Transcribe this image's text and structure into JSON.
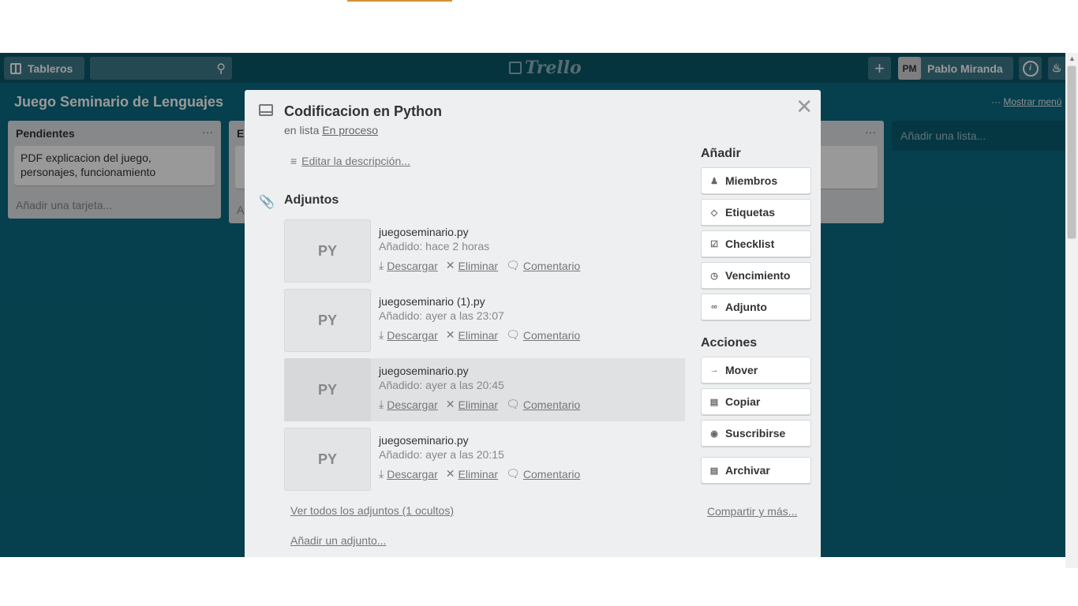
{
  "header": {
    "boards_label": "Tableros",
    "logo": "Trello",
    "user_initials": "PM",
    "user_name": "Pablo Miranda"
  },
  "board": {
    "title": "Juego Seminario de Lenguajes",
    "menu_label": "Mostrar menú",
    "lists": [
      {
        "title": "Pendientes",
        "cards": [
          "PDF explicacion del juego, personajes, funcionamiento"
        ],
        "add_card": "Añadir una tarjeta..."
      },
      {
        "title": "E",
        "add_card": "A"
      }
    ],
    "add_list": "Añadir una lista..."
  },
  "modal": {
    "title": "Codificacion en Python",
    "in_list_prefix": "en lista",
    "list_name": "En proceso",
    "edit_description": "Editar la descripción...",
    "attachments_title": "Adjuntos",
    "attachments": [
      {
        "ext": "PY",
        "name": "juegoseminario.py",
        "date": "Añadido: hace 2 horas"
      },
      {
        "ext": "PY",
        "name": "juegoseminario (1).py",
        "date": "Añadido: ayer a las 23:07"
      },
      {
        "ext": "PY",
        "name": "juegoseminario.py",
        "date": "Añadido: ayer a las 20:45"
      },
      {
        "ext": "PY",
        "name": "juegoseminario.py",
        "date": "Añadido: ayer a las 20:15"
      }
    ],
    "action_download": "Descargar",
    "action_delete": "Eliminar",
    "action_comment": "Comentario",
    "view_all": "Ver todos los adjuntos (1 ocultos)",
    "add_attachment": "Añadir un adjunto...",
    "add_title": "Añadir",
    "add_buttons": [
      "Miembros",
      "Etiquetas",
      "Checklist",
      "Vencimiento",
      "Adjunto"
    ],
    "actions_title": "Acciones",
    "action_buttons": [
      "Mover",
      "Copiar",
      "Suscribirse",
      "Archivar"
    ],
    "share": "Compartir y más..."
  },
  "colors": {
    "board_bg": "#0b6a80",
    "header_bg": "#09576a",
    "modal_bg": "#edeff0"
  }
}
